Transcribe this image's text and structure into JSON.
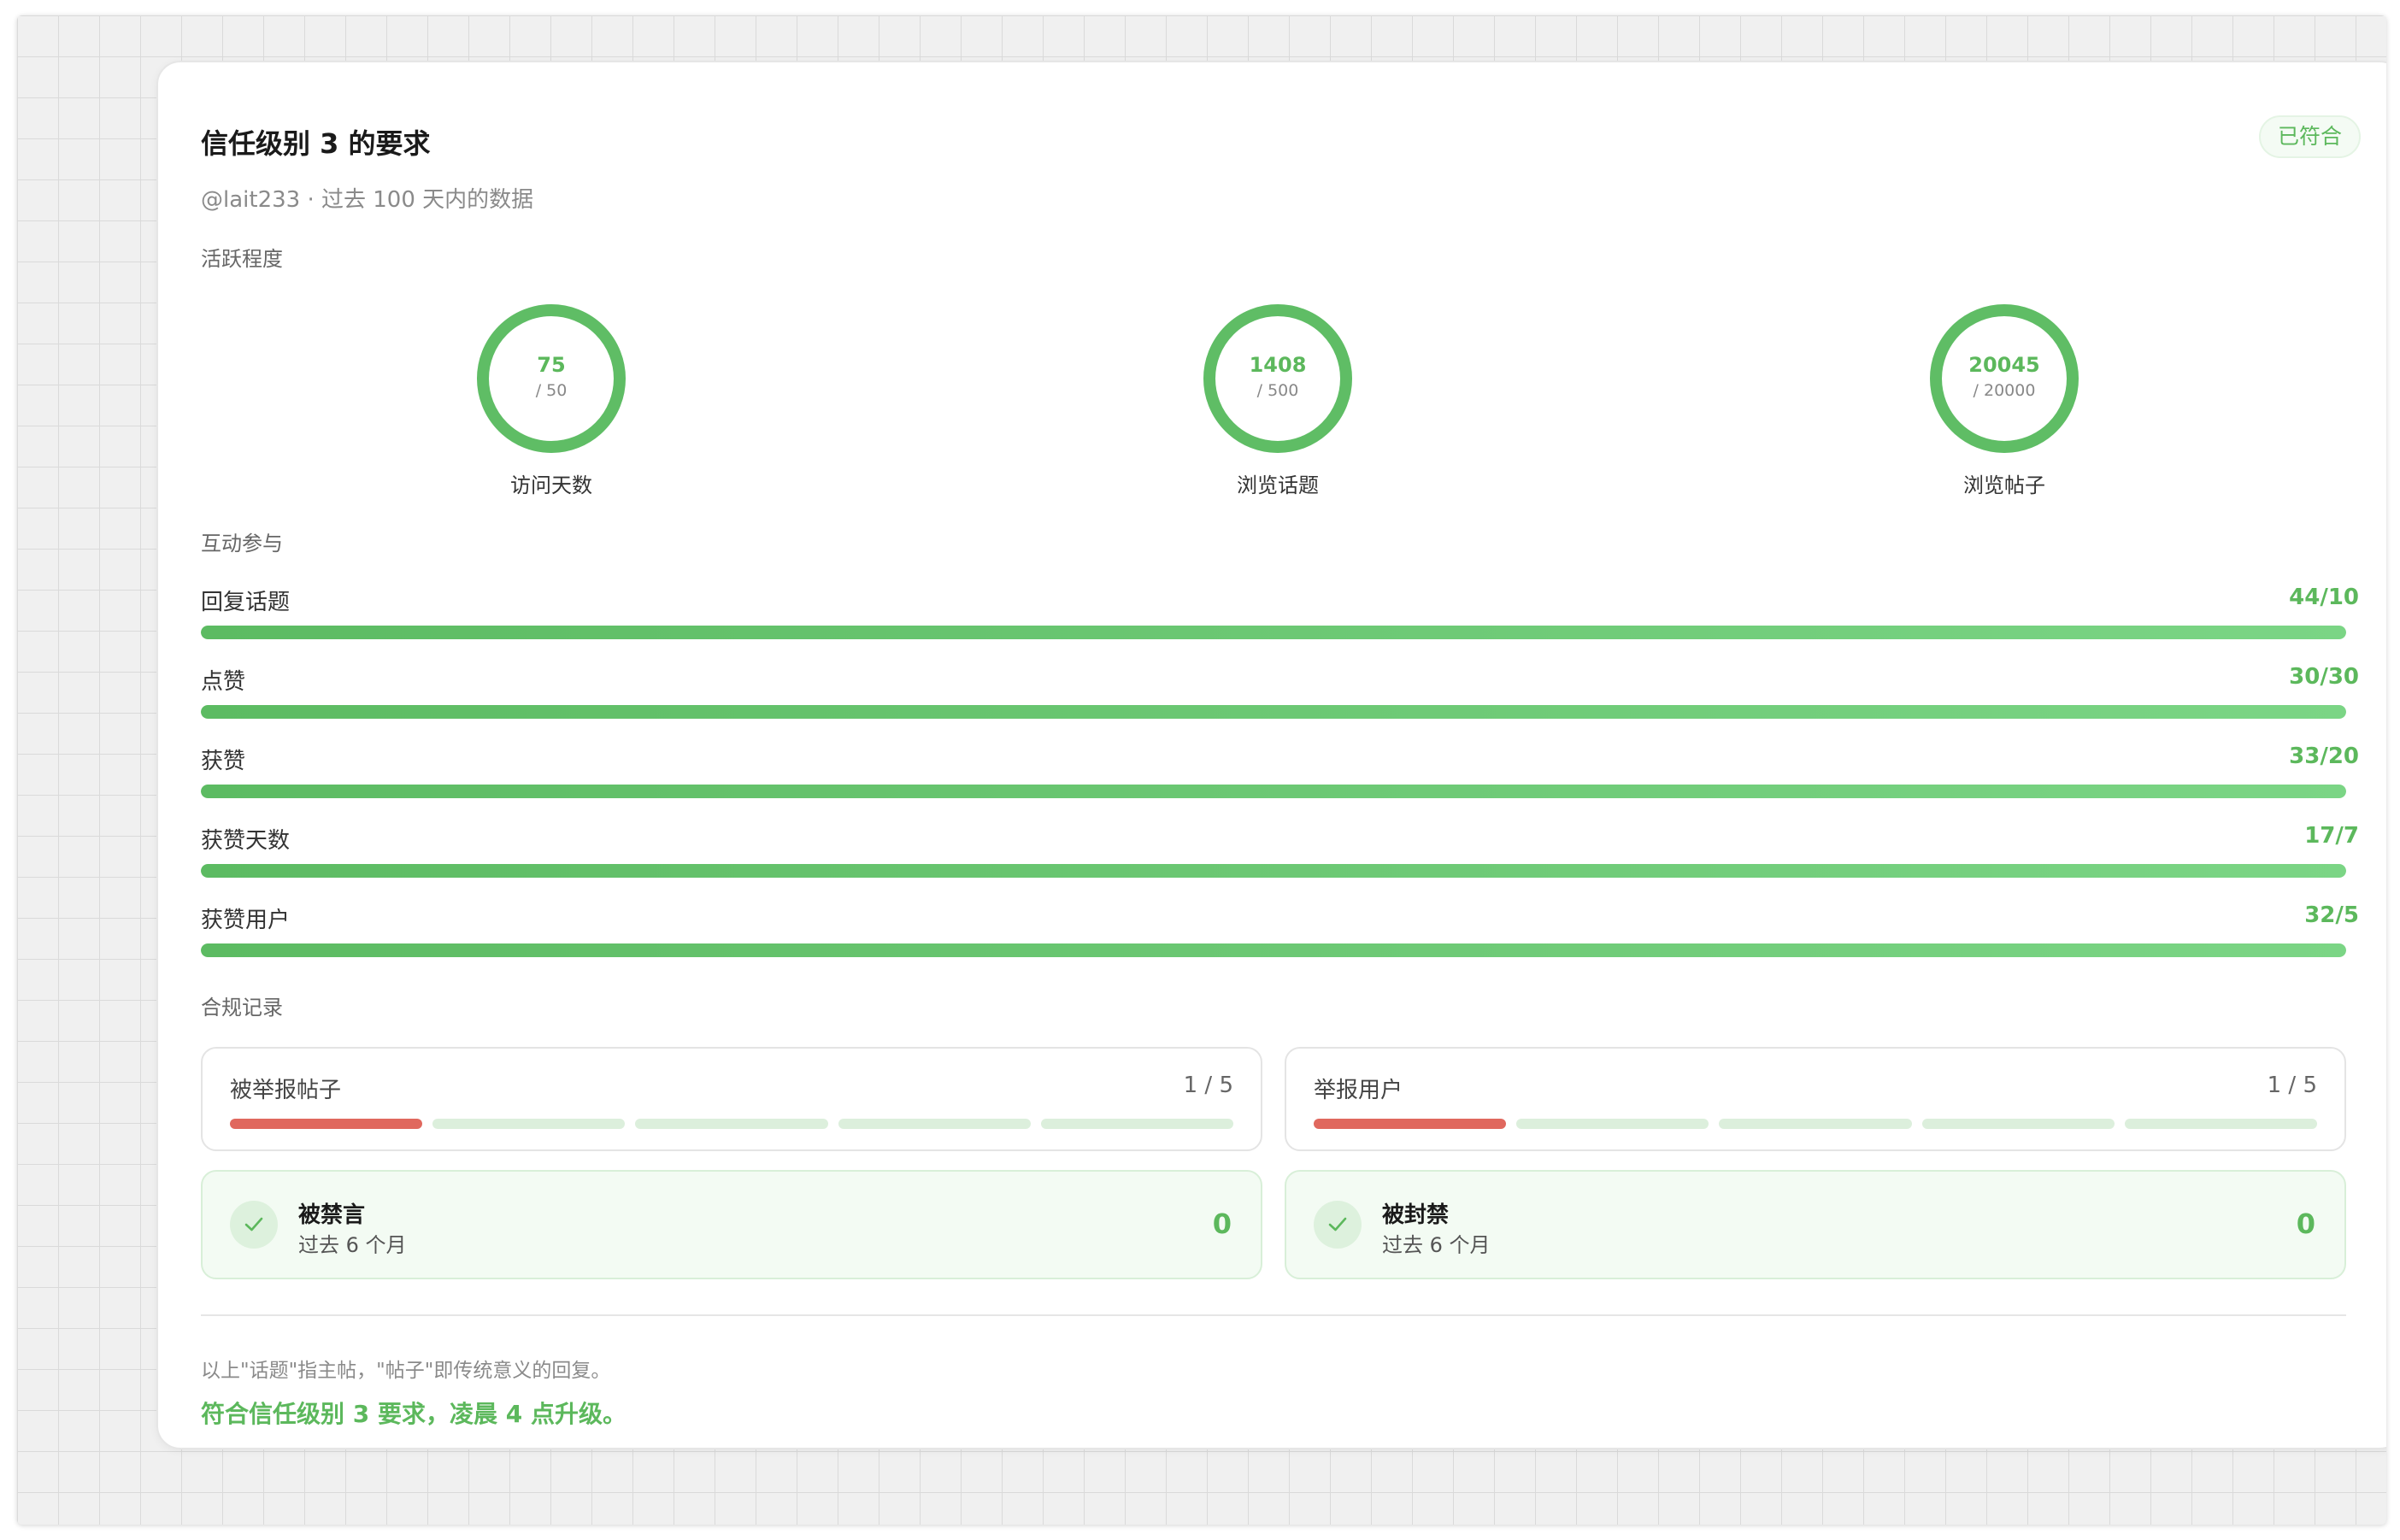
{
  "card": {
    "title": "信任级别 3 的要求",
    "badge": "已符合",
    "subtitle": "@lait233 · 过去 100 天内的数据"
  },
  "activity": {
    "label": "活跃程度",
    "rings": [
      {
        "value": "75",
        "target": "/ 50",
        "label": "访问天数",
        "progress": 1.0
      },
      {
        "value": "1408",
        "target": "/ 500",
        "label": "浏览话题",
        "progress": 1.0
      },
      {
        "value": "20045",
        "target": "/ 20000",
        "label": "浏览帖子",
        "progress": 1.0
      }
    ]
  },
  "engagement": {
    "label": "互动参与",
    "bars": [
      {
        "label": "回复话题",
        "value": "44/10",
        "progress": 1.0
      },
      {
        "label": "点赞",
        "value": "30/30",
        "progress": 1.0
      },
      {
        "label": "获赞",
        "value": "33/20",
        "progress": 1.0
      },
      {
        "label": "获赞天数",
        "value": "17/7",
        "progress": 1.0
      },
      {
        "label": "获赞用户",
        "value": "32/5",
        "progress": 1.0
      }
    ]
  },
  "compliance": {
    "label": "合规记录",
    "reports": [
      {
        "label": "被举报帖子",
        "count": "1 / 5",
        "filled": 1,
        "total": 5
      },
      {
        "label": "举报用户",
        "count": "1 / 5",
        "filled": 1,
        "total": 5
      }
    ],
    "statuses": [
      {
        "title": "被禁言",
        "sub": "过去 6 个月",
        "count": "0",
        "icon": "check-icon"
      },
      {
        "title": "被封禁",
        "sub": "过去 6 个月",
        "count": "0",
        "icon": "check-icon"
      }
    ]
  },
  "footer": {
    "note": "以上\"话题\"指主帖，\"帖子\"即传统意义的回复。",
    "conclusion": "符合信任级别 3 要求，凌晨 4 点升级。"
  },
  "colors": {
    "accent_green": "#5cb85c",
    "danger_red": "#e0685e",
    "track_green": "#e3f3e3"
  }
}
